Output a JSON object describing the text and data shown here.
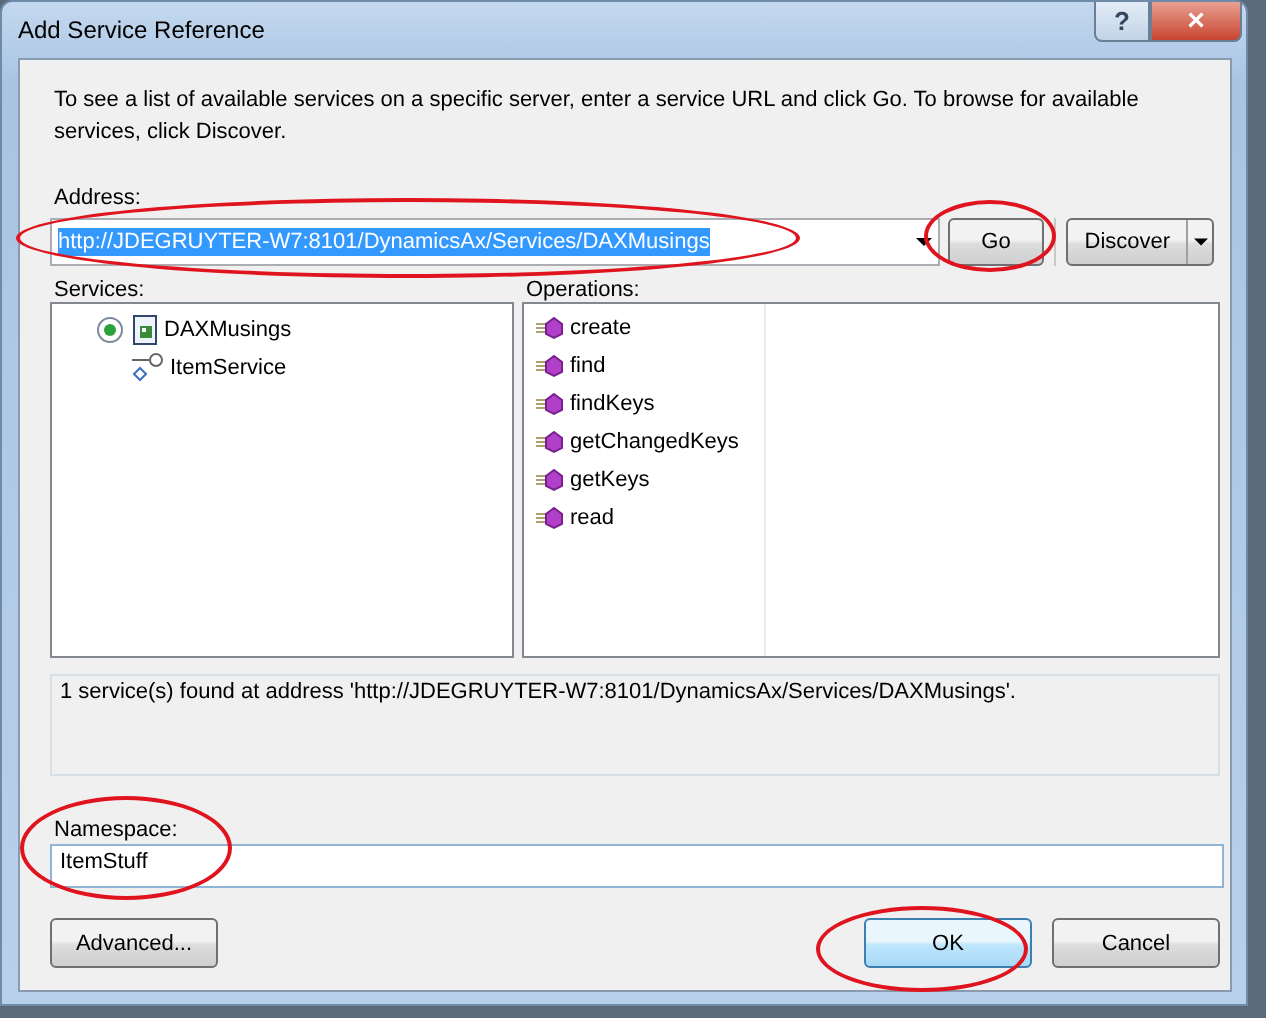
{
  "window": {
    "title": "Add Service Reference",
    "help_button": "?",
    "close_button": "×"
  },
  "intro": "To see a list of available services on a specific server, enter a service URL and click Go. To browse for available services, click Discover.",
  "address": {
    "label": "Address:",
    "value": "http://JDEGRUYTER-W7:8101/DynamicsAx/Services/DAXMusings",
    "text_selected": true
  },
  "go_button": {
    "label": "Go",
    "hovered": false
  },
  "discover_button": {
    "label": "Discover"
  },
  "services": {
    "label": "Services:",
    "items": [
      {
        "label": "DAXMusings",
        "kind": "service",
        "children": [
          {
            "label": "ItemService",
            "kind": "contract"
          }
        ]
      }
    ]
  },
  "operations": {
    "label": "Operations:",
    "items": [
      "create",
      "find",
      "findKeys",
      "getChangedKeys",
      "getKeys",
      "read"
    ]
  },
  "status": "1 service(s) found at address 'http://JDEGRUYTER-W7:8101/DynamicsAx/Services/DAXMusings'.",
  "namespace": {
    "label": "Namespace:",
    "value": "ItemStuff"
  },
  "buttons": [
    {
      "label": "Advanced...",
      "hovered": false
    },
    {
      "label": "OK",
      "hovered": true
    },
    {
      "label": "Cancel",
      "hovered": false
    }
  ]
}
